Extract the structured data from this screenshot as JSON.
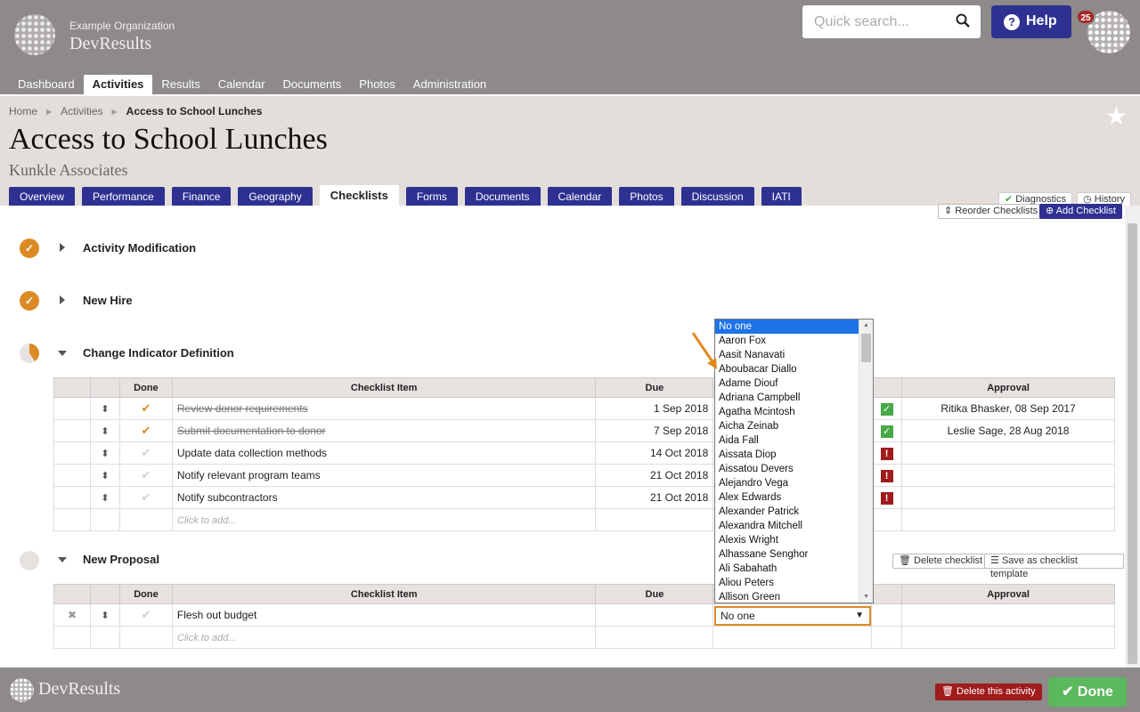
{
  "header": {
    "org_name": "Example Organization",
    "app_name": "DevResults",
    "search_placeholder": "Quick search...",
    "help_label": "Help",
    "notification_count": "25"
  },
  "main_nav": [
    {
      "label": "Dashboard",
      "active": false
    },
    {
      "label": "Activities",
      "active": true
    },
    {
      "label": "Results",
      "active": false
    },
    {
      "label": "Calendar",
      "active": false
    },
    {
      "label": "Documents",
      "active": false
    },
    {
      "label": "Photos",
      "active": false
    },
    {
      "label": "Administration",
      "active": false
    }
  ],
  "breadcrumb": {
    "home": "Home",
    "section": "Activities",
    "current": "Access to School Lunches"
  },
  "page": {
    "title": "Access to School Lunches",
    "subtitle": "Kunkle Associates"
  },
  "tabs": [
    {
      "label": "Overview"
    },
    {
      "label": "Performance"
    },
    {
      "label": "Finance"
    },
    {
      "label": "Geography"
    },
    {
      "label": "Checklists",
      "active": true
    },
    {
      "label": "Forms"
    },
    {
      "label": "Documents"
    },
    {
      "label": "Calendar"
    },
    {
      "label": "Photos"
    },
    {
      "label": "Discussion"
    },
    {
      "label": "IATI"
    }
  ],
  "right_tabs": {
    "diagnostics": "Diagnostics",
    "history": "History"
  },
  "toolbar": {
    "reorder": "Reorder Checklists",
    "add": "Add Checklist"
  },
  "checklists": {
    "activity_modification": {
      "title": "Activity Modification"
    },
    "new_hire": {
      "title": "New Hire"
    },
    "change_indicator": {
      "title": "Change Indicator Definition",
      "columns": {
        "done": "Done",
        "item": "Checklist Item",
        "due": "Due",
        "approval": "Approval"
      },
      "rows": [
        {
          "item": "Review donor requirements",
          "due": "1 Sep 2018",
          "done": true,
          "approval": "Ritika Bhasker, 08 Sep 2017",
          "status": "ok"
        },
        {
          "item": "Submit documentation to donor",
          "due": "7 Sep 2018",
          "done": true,
          "approval": "Leslie Sage, 28 Aug 2018",
          "status": "ok"
        },
        {
          "item": "Update data collection methods",
          "due": "14 Oct 2018",
          "done": false,
          "approval": "",
          "status": "warn"
        },
        {
          "item": "Notify relevant program teams",
          "due": "21 Oct 2018",
          "done": false,
          "approval": "",
          "status": "warn"
        },
        {
          "item": "Notify subcontractors",
          "due": "21 Oct 2018",
          "done": false,
          "approval": "",
          "status": "warn"
        }
      ],
      "add_placeholder": "Click to add..."
    },
    "new_proposal": {
      "title": "New Proposal",
      "delete_label": "Delete checklist",
      "save_template_label": "Save as checklist template",
      "columns": {
        "done": "Done",
        "item": "Checklist Item",
        "due": "Due",
        "approval": "Approval"
      },
      "rows": [
        {
          "item": "Flesh out budget",
          "due": "",
          "assignee": "No one"
        }
      ],
      "add_placeholder": "Click to add..."
    }
  },
  "assignee_dropdown": {
    "selected": "No one",
    "options": [
      "No one",
      "Aaron Fox",
      "Aasit Nanavati",
      "Aboubacar Diallo",
      "Adame Diouf",
      "Adriana Campbell",
      "Agatha Mcintosh",
      "Aicha Zeinab",
      "Aida Fall",
      "Aissata Diop",
      "Aissatou Devers",
      "Alejandro Vega",
      "Alex Edwards",
      "Alexander Patrick",
      "Alexandra Mitchell",
      "Alexis Wright",
      "Alhassane Senghor",
      "Ali Sabahath",
      "Aliou Peters",
      "Allison Green"
    ]
  },
  "footer": {
    "app_name": "DevResults",
    "delete_activity": "Delete this activity",
    "done": "Done"
  },
  "colors": {
    "header_bg": "#8d8a89",
    "tab_blue": "#2e3191",
    "accent_orange": "#dc8a23",
    "ok_green": "#46a846",
    "warn_red": "#a01b1b"
  }
}
